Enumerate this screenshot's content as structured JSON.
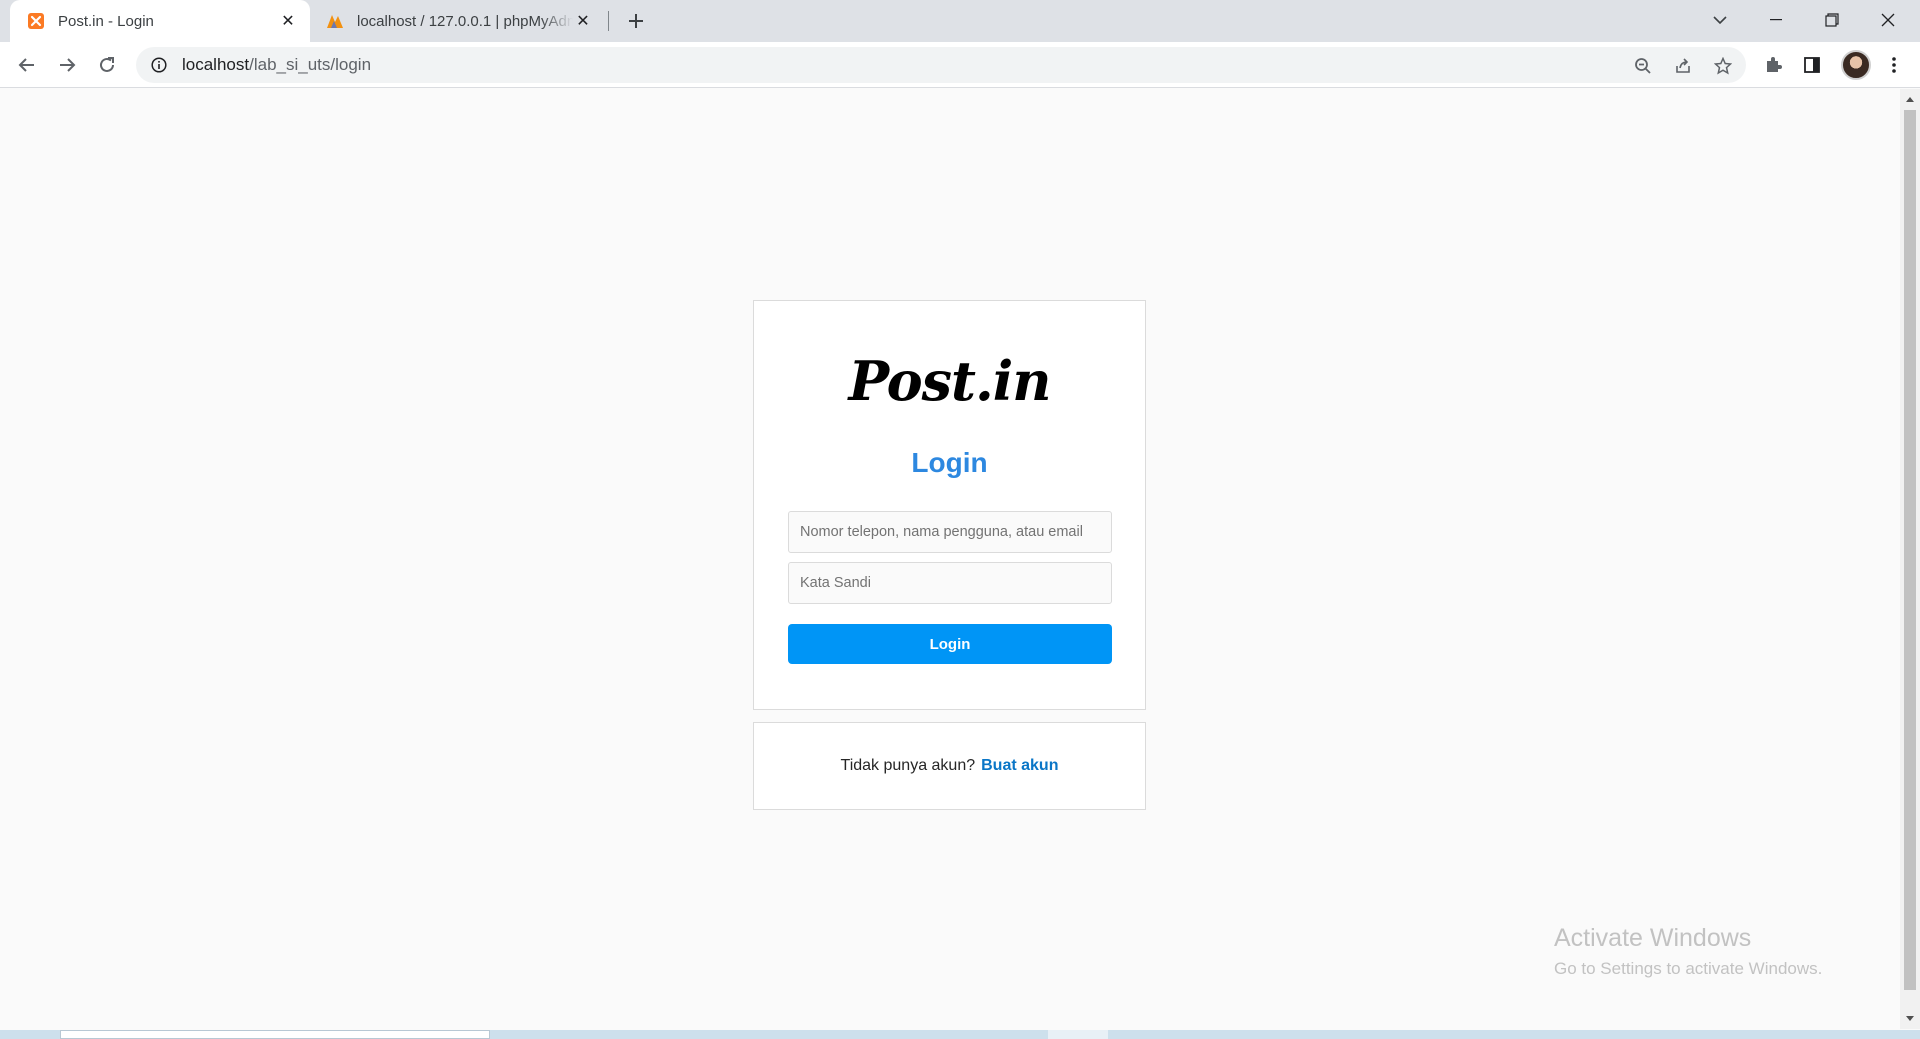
{
  "browser": {
    "tabs": [
      {
        "title": "Post.in - Login",
        "active": true,
        "favicon": "xampp-icon"
      },
      {
        "title": "localhost / 127.0.0.1 | phpMyAdmin",
        "active": false,
        "favicon": "phpmyadmin-icon"
      }
    ],
    "address": {
      "host": "localhost",
      "path": "/lab_si_uts/login"
    }
  },
  "login": {
    "logo": "Post.in",
    "heading": "Login",
    "username_placeholder": "Nomor telepon, nama pengguna, atau email",
    "password_placeholder": "Kata Sandi",
    "submit_label": "Login"
  },
  "signup": {
    "prompt": "Tidak punya akun?",
    "link_label": "Buat akun"
  },
  "watermark": {
    "line1": "Activate Windows",
    "line2": "Go to Settings to activate Windows."
  },
  "colors": {
    "accent": "#0095f6",
    "heading": "#2d88e0",
    "link": "#0a76c7"
  }
}
